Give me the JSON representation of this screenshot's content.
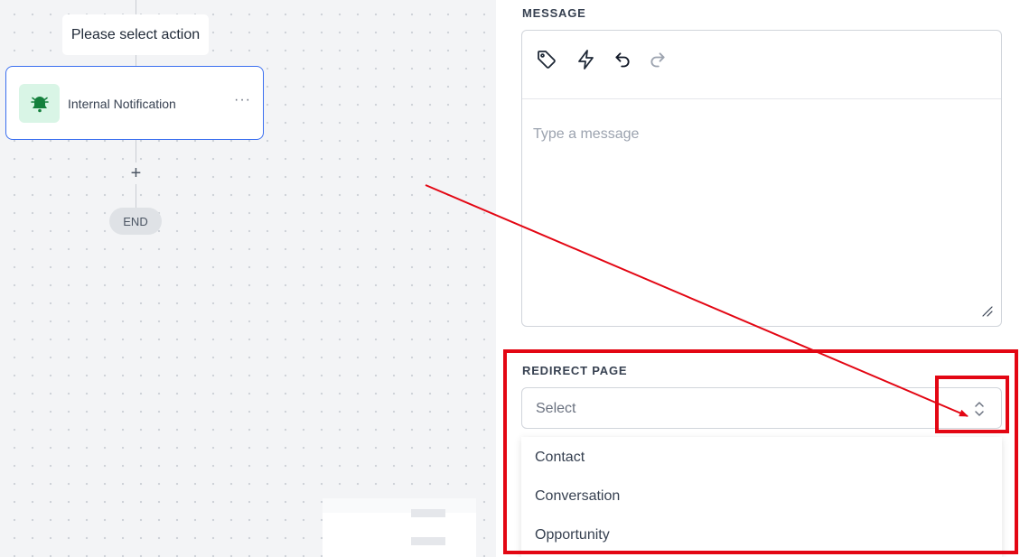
{
  "canvas": {
    "action_prompt": "Please select action",
    "node": {
      "label": "Internal Notification",
      "icon": "alarm-bell-icon",
      "menu_glyph": "···"
    },
    "add_glyph": "+",
    "end_label": "END"
  },
  "panel": {
    "message": {
      "label": "MESSAGE",
      "toolbar": [
        "tag-icon",
        "lightning-icon",
        "undo-icon",
        "redo-icon"
      ],
      "placeholder": "Type a message"
    },
    "redirect": {
      "label": "REDIRECT PAGE",
      "selected": "Select",
      "options": [
        "Contact",
        "Conversation",
        "Opportunity"
      ]
    }
  },
  "colors": {
    "canvas_bg": "#f3f4f6",
    "node_border": "#3b6ff0",
    "node_icon_bg": "#d9f5e6",
    "node_icon_fg": "#15803d",
    "annotation_red": "#e30613"
  }
}
